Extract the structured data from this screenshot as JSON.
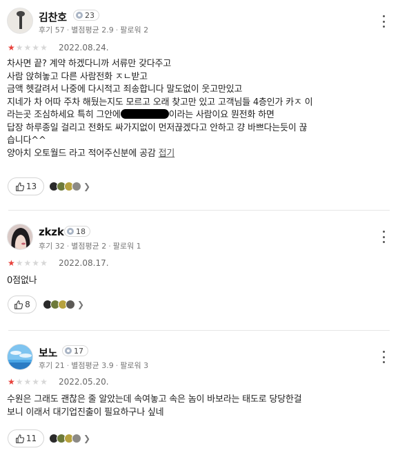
{
  "reviews": [
    {
      "author": "김찬호",
      "level": "23",
      "meta": {
        "reviews": "후기 57",
        "avg": "별점평균 2.9",
        "followers": "팔로워 2"
      },
      "rating": 1,
      "date": "2022.08.24.",
      "lines": [
        "차사면 끝? 계약 하겠다니까 서류만 갖다주고",
        "사람 앉혀놓고 다른 사람전화 ㅈㄴ받고",
        "금액 헷갈려서 나중에 다시적고 죄송합니다 말도없이 웃고만있고",
        "지네가 차 어따 주차 해뒀는지도 모르고 오래 찾고만 있고 고객님들 4층인가 카ㅈ 이",
        "라는곳 조심하세요 특히 그안에",
        "이라는 사람이요 뭔전화 하면",
        "답장 하루종일 걸리고 전화도 싸가지없이 먼저끊겠다고 안하고 걍 바쁘다는듯이 끊",
        "습니다^^",
        "양아치 오토월드 라고 적어주신분에 공감"
      ],
      "fold_label": "접기",
      "likes": "13"
    },
    {
      "author": "zkzk",
      "level": "18",
      "meta": {
        "reviews": "후기 32",
        "avg": "별점평균 2",
        "followers": "팔로워 1"
      },
      "rating": 1,
      "date": "2022.08.17.",
      "lines": [
        "0점없나"
      ],
      "likes": "8"
    },
    {
      "author": "보노",
      "level": "17",
      "meta": {
        "reviews": "후기 21",
        "avg": "별점평균 3.9",
        "followers": "팔로워 3"
      },
      "rating": 1,
      "date": "2022.05.20.",
      "lines": [
        "수원은 그래도 괜찮은 줄 알았는데 속여놓고 속은 놈이 바보라는 태도로 당당한걸",
        "보니 이래서 대기업진출이 필요하구나 싶네"
      ],
      "likes": "11"
    }
  ],
  "icons": {
    "star": "★",
    "more": "more-vertical-icon",
    "like": "thumbs-up-icon",
    "chevron": "chevron-right-icon"
  },
  "colors": {
    "star_on": "#e8413b",
    "star_off": "#d7d7d7"
  }
}
